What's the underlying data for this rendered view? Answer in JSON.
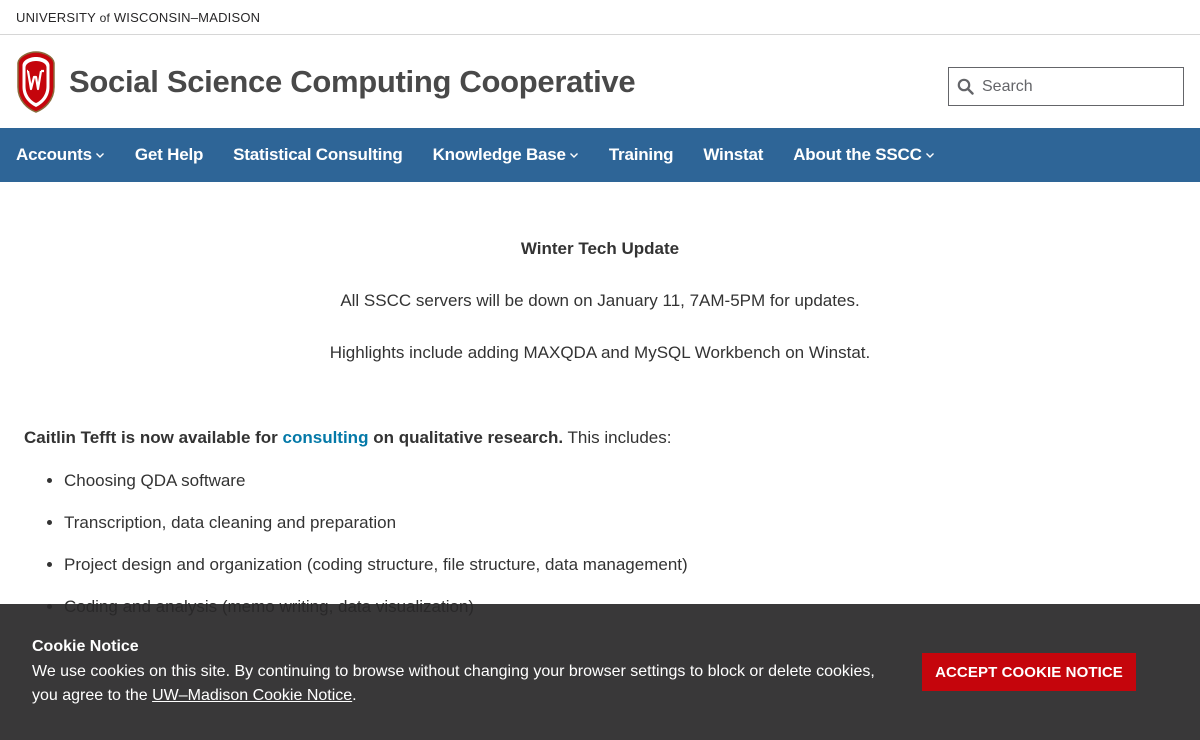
{
  "topbar": {
    "univ_part1": "UNIVERSITY",
    "univ_of": "of",
    "univ_part2": "WISCONSIN–MADISON"
  },
  "header": {
    "site_title": "Social Science Computing Cooperative",
    "search_placeholder": "Search"
  },
  "nav": {
    "items": [
      {
        "label": "Accounts",
        "has_dropdown": true
      },
      {
        "label": "Get Help",
        "has_dropdown": false
      },
      {
        "label": "Statistical Consulting",
        "has_dropdown": false
      },
      {
        "label": "Knowledge Base",
        "has_dropdown": true
      },
      {
        "label": "Training",
        "has_dropdown": false
      },
      {
        "label": "Winstat",
        "has_dropdown": false
      },
      {
        "label": "About the SSCC",
        "has_dropdown": true
      }
    ]
  },
  "notice": {
    "title": "Winter Tech Update",
    "line1": "All SSCC servers will be down on January 11, 7AM-5PM for updates.",
    "line2": "Highlights include adding MAXQDA and MySQL Workbench on Winstat."
  },
  "consult": {
    "bold_before": "Caitlin Tefft is now available for",
    "link": "consulting",
    "bold_after": "on qualitative research.",
    "plain": "This includes:",
    "items": [
      "Choosing QDA software",
      "Transcription, data cleaning and preparation",
      "Project design and organization (coding structure, file structure, data management)",
      "Coding and analysis (memo writing, data visualization)"
    ]
  },
  "cookie": {
    "title": "Cookie Notice",
    "text": "We use cookies on this site. By continuing to browse without changing your browser settings to block or delete cookies, you agree to the",
    "link": "UW–Madison Cookie Notice",
    "button": "ACCEPT COOKIE NOTICE"
  },
  "colors": {
    "nav_bg": "#2e6597",
    "accent_red": "#c5050c",
    "link_blue": "#0479a8"
  }
}
